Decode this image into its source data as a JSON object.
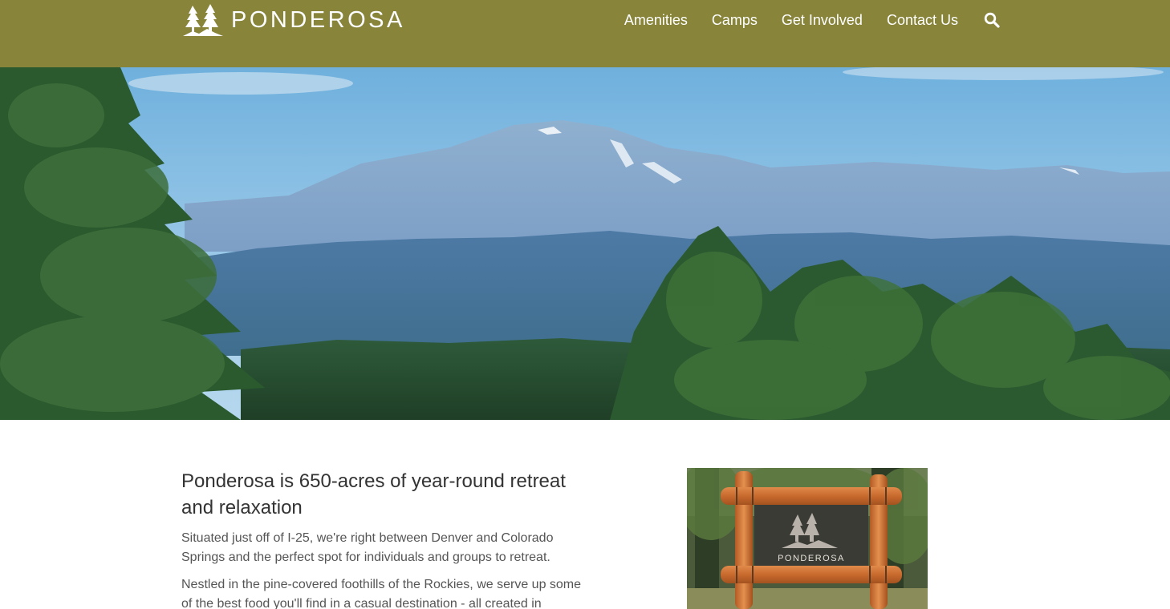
{
  "header": {
    "brand": "PONDEROSA",
    "logo_icon": "pine-trees-logo-icon",
    "nav": [
      {
        "label": "Amenities"
      },
      {
        "label": "Camps"
      },
      {
        "label": "Get Involved"
      },
      {
        "label": "Contact Us"
      }
    ],
    "search_icon": "search-icon"
  },
  "hero": {
    "image": "mountain-landscape-photo"
  },
  "intro": {
    "heading": "Ponderosa is 650-acres of year-round retreat and relaxation",
    "paragraphs": [
      "Situated just off of I-25, we're right between Denver and Colorado Springs and the perfect spot for individuals and groups to retreat.",
      "Nestled in the pine-covered foothills of the Rockies, we serve up some of the best food you'll find in a casual destination - all created in"
    ]
  },
  "sign_photo": {
    "image": "ponderosa-entrance-sign-photo",
    "sign_text": "PONDEROSA"
  },
  "colors": {
    "header_bg": "#88853b",
    "nav_text": "#ffffff",
    "body_text": "#555555",
    "heading_text": "#333333"
  }
}
